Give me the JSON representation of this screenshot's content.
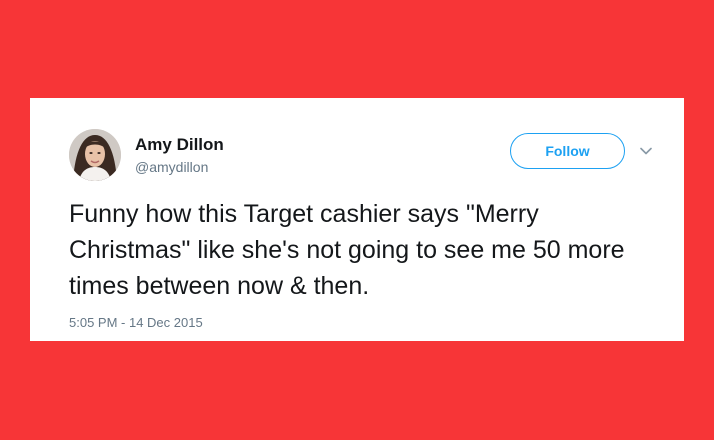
{
  "colors": {
    "background": "#f73537",
    "card": "#ffffff",
    "accent": "#1da1f2",
    "text": "#14171a",
    "muted": "#657786"
  },
  "tweet": {
    "author": {
      "display_name": "Amy Dillon",
      "handle": "@amydillon",
      "avatar_icon": "profile-photo"
    },
    "follow_label": "Follow",
    "menu_icon": "chevron-down-icon",
    "text": "Funny how this Target cashier says \"Merry Christmas\" like she's not going to see me 50 more times between now & then.",
    "timestamp": "5:05 PM - 14 Dec 2015"
  }
}
